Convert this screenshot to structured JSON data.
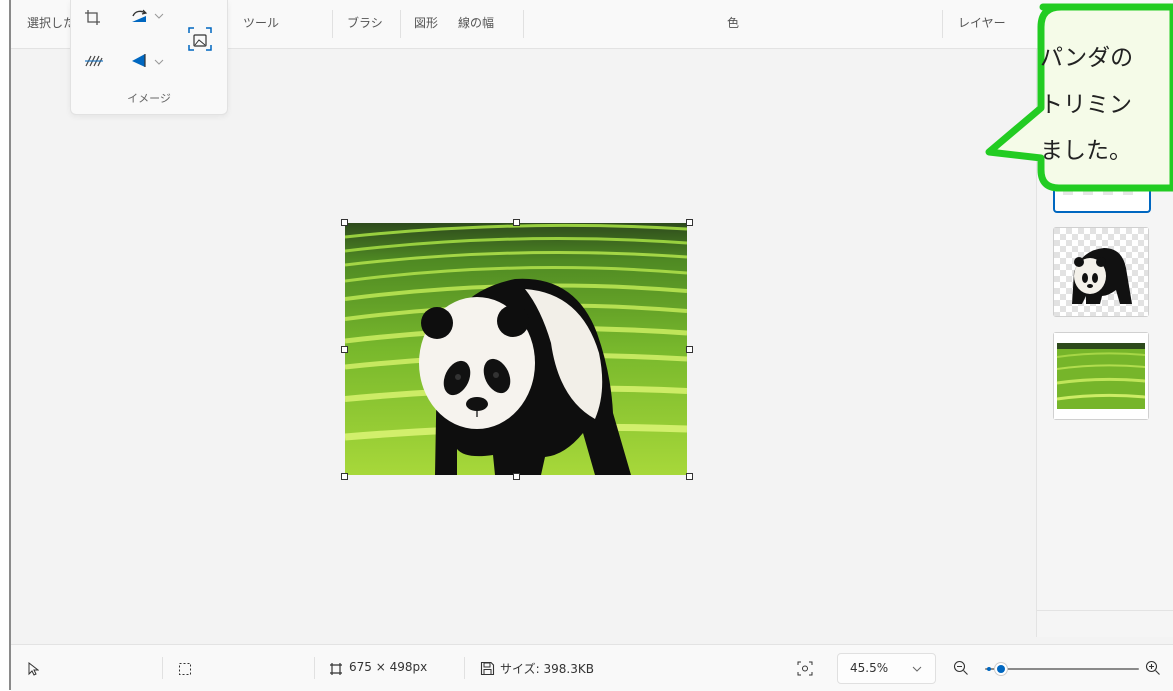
{
  "ribbon": {
    "selection_label": "選択した",
    "tools_label": "ツール",
    "brush_label": "ブラシ",
    "shapes_label": "図形",
    "line_width_label": "線の幅",
    "color_label": "色",
    "layers_label": "レイヤー"
  },
  "image_panel": {
    "caption": "イメージ"
  },
  "status": {
    "canvas_size": "675 × 498px",
    "file_size": "サイズ: 398.3KB",
    "zoom_value": "45.5%",
    "zoom_slider_level": 0.12
  },
  "callout": {
    "lines": [
      "パンダの",
      "トリミン",
      "ました。"
    ]
  },
  "colors": {
    "accent": "#0067c0",
    "callout_border": "#22cc22",
    "callout_fill": "#f5fbe8"
  }
}
